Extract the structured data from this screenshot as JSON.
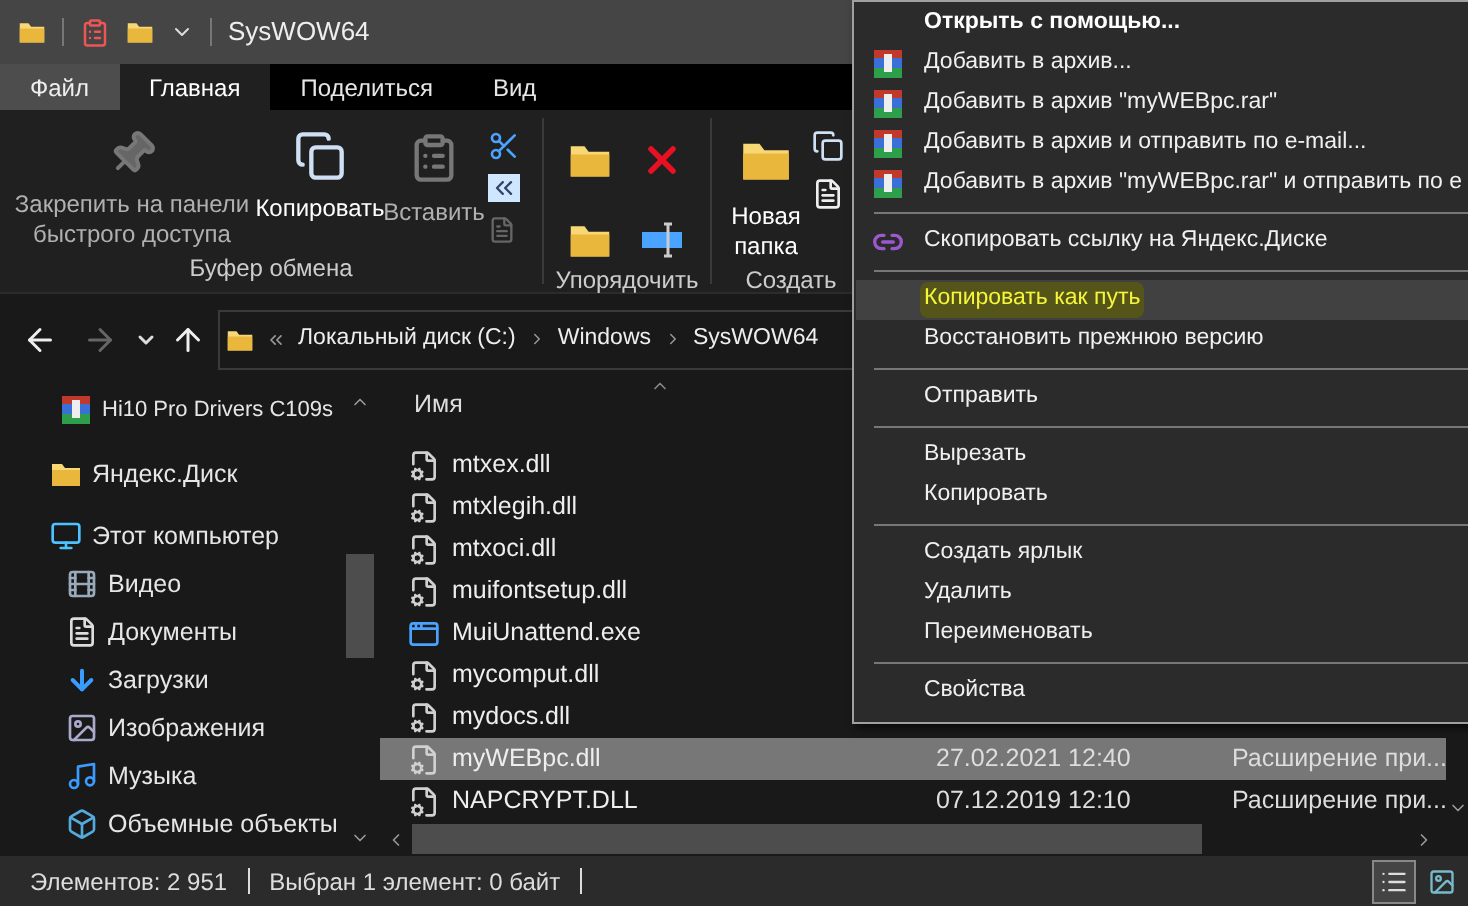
{
  "window": {
    "title": "SysWOW64"
  },
  "ribbon_tabs": [
    {
      "label": "Файл",
      "kind": "file",
      "selected": false
    },
    {
      "label": "Главная",
      "kind": "tab",
      "selected": true
    },
    {
      "label": "Поделиться",
      "kind": "tab",
      "selected": false
    },
    {
      "label": "Вид",
      "kind": "tab",
      "selected": false
    }
  ],
  "ribbon_groups": [
    {
      "label": "Буфер обмена",
      "buttons": [
        {
          "label": "Закрепить на панели быстрого доступа",
          "disabled": true
        },
        {
          "label": "Копировать",
          "disabled": false
        },
        {
          "label": "Вставить",
          "disabled": true
        }
      ]
    },
    {
      "label": "Упорядочить"
    },
    {
      "label": "Создать",
      "buttons": [
        {
          "label": "Новая папка",
          "disabled": false
        }
      ]
    }
  ],
  "nav": {
    "back": {
      "disabled": false
    },
    "forward": {
      "disabled": true
    }
  },
  "breadcrumbs": [
    "Локальный диск (C:)",
    "Windows",
    "SysWOW64"
  ],
  "sidebar": {
    "pinned": [
      {
        "label": "Hi10 Pro Drivers C109s",
        "kind": "archive"
      }
    ],
    "items": [
      {
        "label": "Яндекс.Диск",
        "kind": "cloud"
      },
      {
        "label": "Этот компьютер",
        "kind": "computer",
        "children": [
          {
            "label": "Видео",
            "kind": "video"
          },
          {
            "label": "Документы",
            "kind": "documents"
          },
          {
            "label": "Загрузки",
            "kind": "downloads"
          },
          {
            "label": "Изображения",
            "kind": "pictures"
          },
          {
            "label": "Музыка",
            "kind": "music"
          },
          {
            "label": "Объемные объекты",
            "kind": "objects"
          }
        ]
      }
    ]
  },
  "file_list": {
    "columns": [
      {
        "label": "Имя"
      }
    ],
    "rows": [
      {
        "name": "mtxex.dll",
        "kind": "dll",
        "selected": false
      },
      {
        "name": "mtxlegih.dll",
        "kind": "dll",
        "selected": false
      },
      {
        "name": "mtxoci.dll",
        "kind": "dll",
        "selected": false
      },
      {
        "name": "muifontsetup.dll",
        "kind": "dll",
        "selected": false
      },
      {
        "name": "MuiUnattend.exe",
        "kind": "exe",
        "selected": false
      },
      {
        "name": "mycomput.dll",
        "kind": "dll",
        "selected": false
      },
      {
        "name": "mydocs.dll",
        "kind": "dll",
        "selected": false
      },
      {
        "name": "myWEBpc.dll",
        "kind": "dll",
        "selected": true,
        "date": "27.02.2021 12:40",
        "type": "Расширение при..."
      },
      {
        "name": "NAPCRYPT.DLL",
        "kind": "dll",
        "selected": false,
        "date": "07.12.2019 12:10",
        "type": "Расширение при..."
      }
    ]
  },
  "context_menu": {
    "groups": [
      [
        {
          "label": "Открыть с помощью...",
          "kind": "default",
          "selected": false
        },
        {
          "label": "Добавить в архив...",
          "kind": "archive",
          "selected": false
        },
        {
          "label": "Добавить в архив \"myWEBpc.rar\"",
          "kind": "archive",
          "selected": false
        },
        {
          "label": "Добавить в архив и отправить по e-mail...",
          "kind": "archive",
          "selected": false
        },
        {
          "label": "Добавить в архив \"myWEBpc.rar\" и отправить по e",
          "kind": "archive",
          "selected": false
        }
      ],
      [
        {
          "label": "Скопировать ссылку на Яндекс.Диске",
          "kind": "link",
          "selected": false
        }
      ],
      [
        {
          "label": "Копировать как путь",
          "kind": "plain",
          "selected": true
        },
        {
          "label": "Восстановить прежнюю версию",
          "kind": "plain",
          "selected": false
        }
      ],
      [
        {
          "label": "Отправить",
          "kind": "plain",
          "selected": false
        }
      ],
      [
        {
          "label": "Вырезать",
          "kind": "plain",
          "selected": false
        },
        {
          "label": "Копировать",
          "kind": "plain",
          "selected": false
        }
      ],
      [
        {
          "label": "Создать ярлык",
          "kind": "plain",
          "selected": false
        },
        {
          "label": "Удалить",
          "kind": "plain",
          "selected": false
        },
        {
          "label": "Переименовать",
          "kind": "plain",
          "selected": false
        }
      ],
      [
        {
          "label": "Свойства",
          "kind": "plain",
          "selected": false
        }
      ]
    ]
  },
  "status_bar": {
    "items": [
      "Элементов: 2 951",
      "Выбран 1 элемент: 0 байт"
    ],
    "views": [
      {
        "kind": "details",
        "selected": true
      },
      {
        "kind": "thumbnails",
        "selected": false
      }
    ]
  }
}
